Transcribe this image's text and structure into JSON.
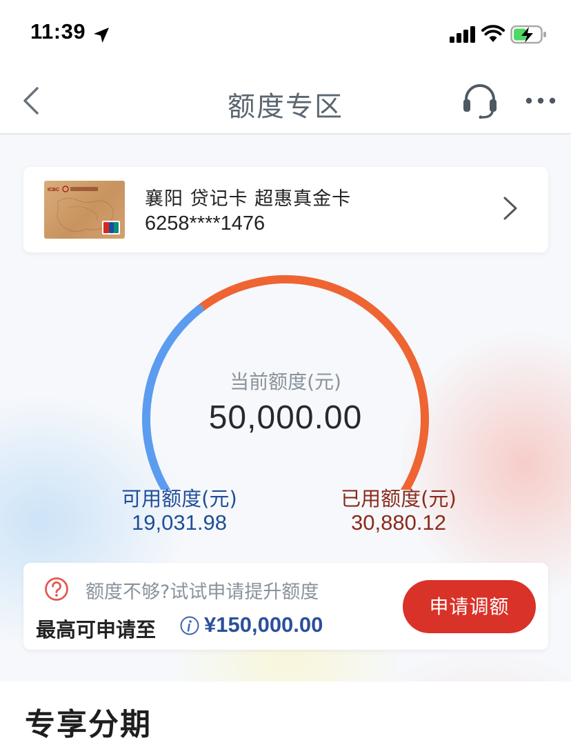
{
  "status_bar": {
    "time": "11:39",
    "icons": [
      "location-arrow-icon",
      "signal-icon",
      "wifi-icon",
      "battery-charging-icon"
    ]
  },
  "nav": {
    "title": "额度专区",
    "back_icon": "chevron-left-icon",
    "service_icon": "headset-icon",
    "more_icon": "more-dots-icon"
  },
  "card": {
    "name": "襄阳 贷记卡 超惠真金卡",
    "number": "6258****1476",
    "thumbnail_brand": "ICBC 中国工商银行",
    "thumbnail_network": "UnionPay 银联"
  },
  "limit": {
    "caption": "当前额度(元)",
    "total": "50,000.00",
    "available_label": "可用额度(元)",
    "available_value": "19,031.98",
    "used_label": "已用额度(元)",
    "used_value": "30,880.12",
    "available_share": 0.381,
    "available_color": "#5b9cf0",
    "used_color": "#ee6433"
  },
  "increase": {
    "hint": "额度不够?试试申请提升额度",
    "max_label": "最高可申请至",
    "max_amount": "¥150,000.00",
    "button_label": "申请调额",
    "help_icon": "question-circle-icon",
    "info_icon": "info-circle-icon"
  },
  "section": {
    "title": "专享分期"
  },
  "colors": {
    "accent_red": "#d93228",
    "amount_blue": "#2b4f9b",
    "available_text": "#1f4d98",
    "used_text": "#8a2a1c"
  }
}
